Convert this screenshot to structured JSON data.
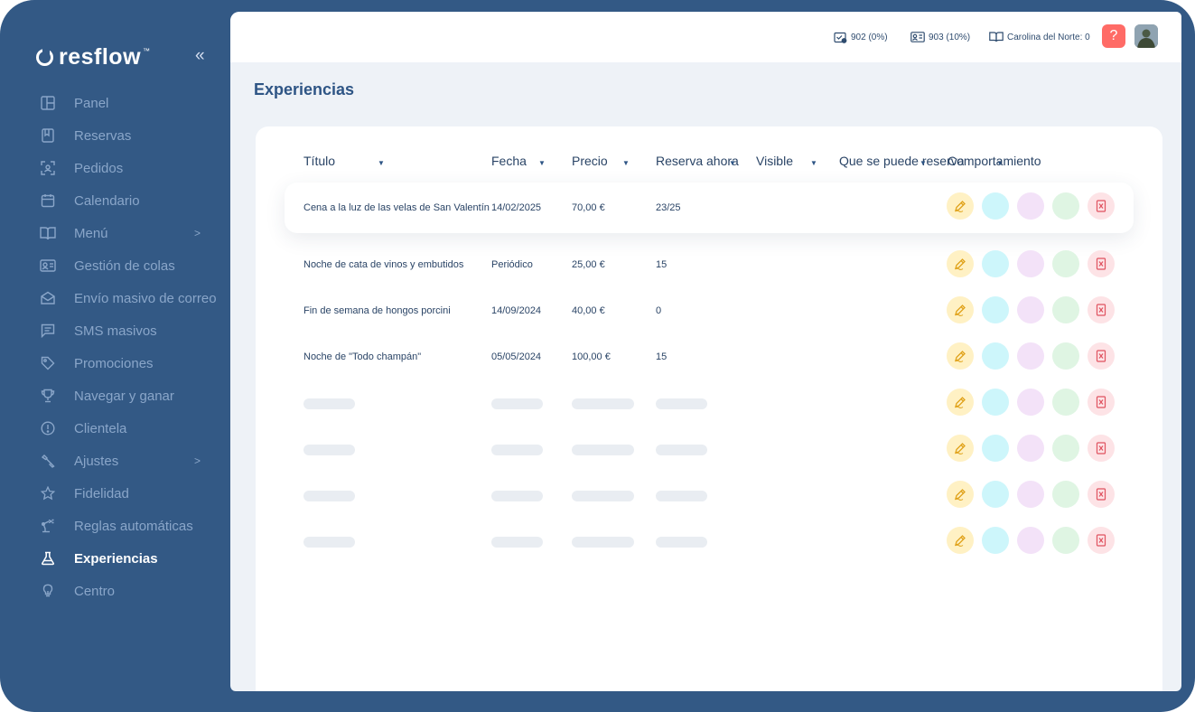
{
  "app": {
    "name": "resflow",
    "tm": "™"
  },
  "sidebar": {
    "collapse_label": "«",
    "items": [
      {
        "label": "Panel",
        "icon": "layout-icon"
      },
      {
        "label": "Reservas",
        "icon": "bookmark-icon"
      },
      {
        "label": "Pedidos",
        "icon": "scan-icon"
      },
      {
        "label": "Calendario",
        "icon": "calendar-icon"
      },
      {
        "label": "Menú",
        "icon": "book-open-icon",
        "arrow": ">"
      },
      {
        "label": "Gestión de colas",
        "icon": "id-card-icon"
      },
      {
        "label": "Envío masivo de correo",
        "icon": "mail-icon"
      },
      {
        "label": "SMS masivos",
        "icon": "message-icon"
      },
      {
        "label": "Promociones",
        "icon": "tag-icon"
      },
      {
        "label": "Navegar y ganar",
        "icon": "trophy-icon"
      },
      {
        "label": "Clientela",
        "icon": "info-icon"
      },
      {
        "label": "Ajustes",
        "icon": "wrench-icon",
        "arrow": ">"
      },
      {
        "label": "Fidelidad",
        "icon": "star-icon"
      },
      {
        "label": "Reglas automáticas",
        "icon": "robot-arm-icon"
      },
      {
        "label": "Experiencias",
        "icon": "flask-icon",
        "active": true
      },
      {
        "label": "Centro",
        "icon": "bulb-icon"
      }
    ]
  },
  "topbar": {
    "stat1": "902 (0%)",
    "stat2": "903 (10%)",
    "stat3": "Carolina del Norte: 0",
    "help": "?"
  },
  "page": {
    "title": "Experiencias"
  },
  "table": {
    "headers": [
      "Título",
      "Fecha",
      "Precio",
      "Reserva ahora",
      "Visible",
      "Que se puede reservar",
      "Comportamiento"
    ],
    "rows": [
      {
        "title": "Cena a la luz de las velas de San Valentín",
        "date": "14/02/2025",
        "price": "70,00 €",
        "reserve": "23/25"
      },
      {
        "title": "Noche de cata de vinos y embutidos",
        "date": "Periódico",
        "price": "25,00 €",
        "reserve": "15"
      },
      {
        "title": "Fin de semana de hongos porcini",
        "date": "14/09/2024",
        "price": "40,00 €",
        "reserve": "0"
      },
      {
        "title": "Noche de \"Todo champán\"",
        "date": "05/05/2024",
        "price": "100,00 €",
        "reserve": "15"
      }
    ]
  },
  "colors": {
    "sidebar_bg": "#335985",
    "accent": "#2e5585",
    "help": "#ff6b66",
    "edit": "#fff1c4",
    "cyan": "#cdf6fb",
    "purple": "#f3e2f8",
    "green": "#dff5e3",
    "delete": "#fde3e6"
  }
}
